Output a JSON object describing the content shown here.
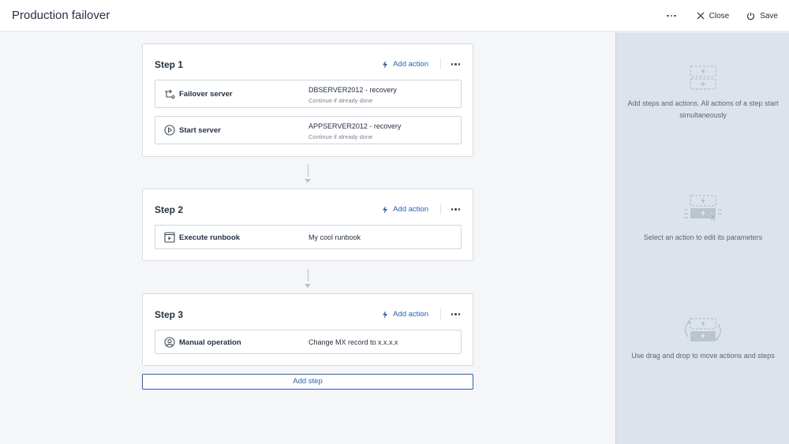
{
  "header": {
    "title": "Production failover",
    "more_icon": "ellipsis-icon",
    "close_label": "Close",
    "save_label": "Save"
  },
  "steps": [
    {
      "title": "Step 1",
      "add_action_label": "Add action",
      "actions": [
        {
          "icon": "failover-icon",
          "name": "Failover server",
          "value": "DBSERVER2012 - recovery",
          "sub": "Continue if already done"
        },
        {
          "icon": "play-circle-icon",
          "name": "Start server",
          "value": "APPSERVER2012 - recovery",
          "sub": "Continue if already done"
        }
      ]
    },
    {
      "title": "Step 2",
      "add_action_label": "Add action",
      "actions": [
        {
          "icon": "runbook-icon",
          "name": "Execute runbook",
          "value": "My cool runbook"
        }
      ]
    },
    {
      "title": "Step 3",
      "add_action_label": "Add action",
      "actions": [
        {
          "icon": "user-circle-icon",
          "name": "Manual operation",
          "value": "Change MX record to x.x.x.x"
        }
      ]
    }
  ],
  "add_step_label": "Add step",
  "sidebar": {
    "hints": [
      "Add steps and actions. All actions of a step start simultaneously",
      "Select an action to edit its parameters",
      "Use drag and drop to move actions and steps"
    ]
  },
  "colors": {
    "accent": "#2b5faa",
    "sidebar_bg": "#dde3ea",
    "canvas_bg": "#f4f6f8"
  }
}
